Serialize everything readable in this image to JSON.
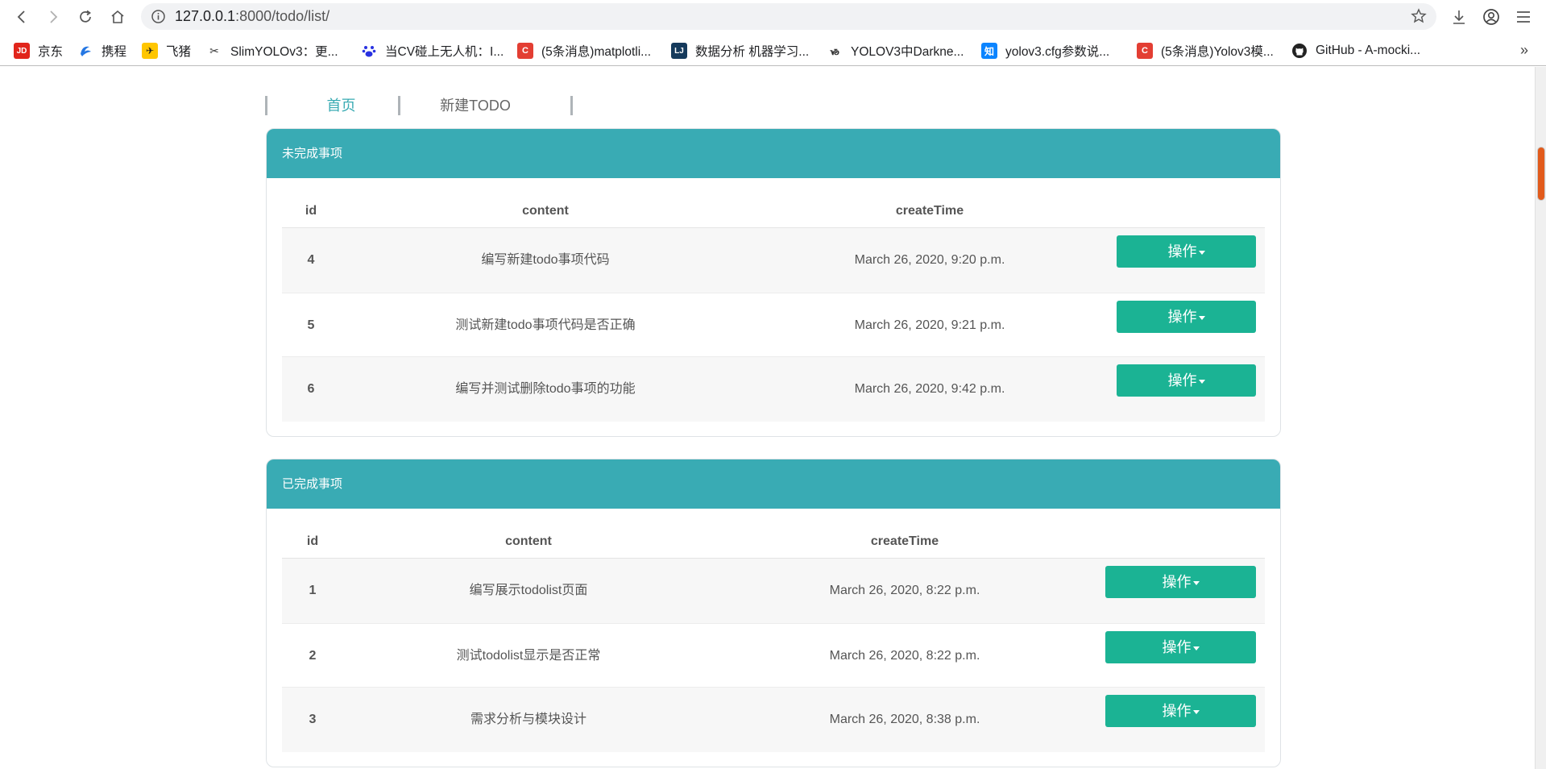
{
  "browser": {
    "url_host": "127.0.0.1",
    "url_path": ":8000/todo/list/",
    "bookmarks": [
      {
        "label": "京东",
        "icon": "jd-icon",
        "color": "#e1251b",
        "glyph": "JD"
      },
      {
        "label": "携程",
        "icon": "ctrip-icon",
        "color": "#2577e3",
        "glyph": "C"
      },
      {
        "label": "飞猪",
        "icon": "fliggy-icon",
        "color": "#ffc600",
        "glyph": "F"
      },
      {
        "label": "SlimYOLOv3：更...",
        "icon": "scissors-icon",
        "color": "#ffffff",
        "glyph": "✂"
      },
      {
        "label": "当CV碰上无人机：I...",
        "icon": "baidu-paw-icon",
        "color": "#2932e1",
        "glyph": "❀"
      },
      {
        "label": "(5条消息)matplotli...",
        "icon": "csdn-icon",
        "color": "#e33e33",
        "glyph": "C"
      },
      {
        "label": "数据分析 机器学习...",
        "icon": "lj-icon",
        "color": "#153a5c",
        "glyph": "LJ"
      },
      {
        "label": "YOLOV3中Darkne...",
        "icon": "jianshu-icon",
        "color": "#ffffff",
        "glyph": "Ꮙ"
      },
      {
        "label": "yolov3.cfg参数说...",
        "icon": "zhihu-icon",
        "color": "#0b84ff",
        "glyph": "知"
      },
      {
        "label": "(5条消息)Yolov3模...",
        "icon": "csdn-icon",
        "color": "#e33e33",
        "glyph": "C"
      },
      {
        "label": "GitHub - A-mocki...",
        "icon": "github-icon",
        "color": "#ffffff",
        "glyph": "●"
      }
    ],
    "more_glyph": "»"
  },
  "nav": {
    "home": "首页",
    "new_todo": "新建TODO"
  },
  "colors": {
    "accent": "#39abb4",
    "button": "#1bb394"
  },
  "incomplete": {
    "title": "未完成事项",
    "headers": {
      "id": "id",
      "content": "content",
      "createTime": "createTime"
    },
    "rows": [
      {
        "id": "4",
        "content": "编写新建todo事项代码",
        "createTime": "March 26, 2020, 9:20 p.m.",
        "action": "操作"
      },
      {
        "id": "5",
        "content": "测试新建todo事项代码是否正确",
        "createTime": "March 26, 2020, 9:21 p.m.",
        "action": "操作"
      },
      {
        "id": "6",
        "content": "编写并测试删除todo事项的功能",
        "createTime": "March 26, 2020, 9:42 p.m.",
        "action": "操作"
      }
    ]
  },
  "complete": {
    "title": "已完成事项",
    "headers": {
      "id": "id",
      "content": "content",
      "createTime": "createTime"
    },
    "rows": [
      {
        "id": "1",
        "content": "编写展示todolist页面",
        "createTime": "March 26, 2020, 8:22 p.m.",
        "action": "操作"
      },
      {
        "id": "2",
        "content": "测试todolist显示是否正常",
        "createTime": "March 26, 2020, 8:22 p.m.",
        "action": "操作"
      },
      {
        "id": "3",
        "content": "需求分析与模块设计",
        "createTime": "March 26, 2020, 8:38 p.m.",
        "action": "操作"
      }
    ]
  }
}
